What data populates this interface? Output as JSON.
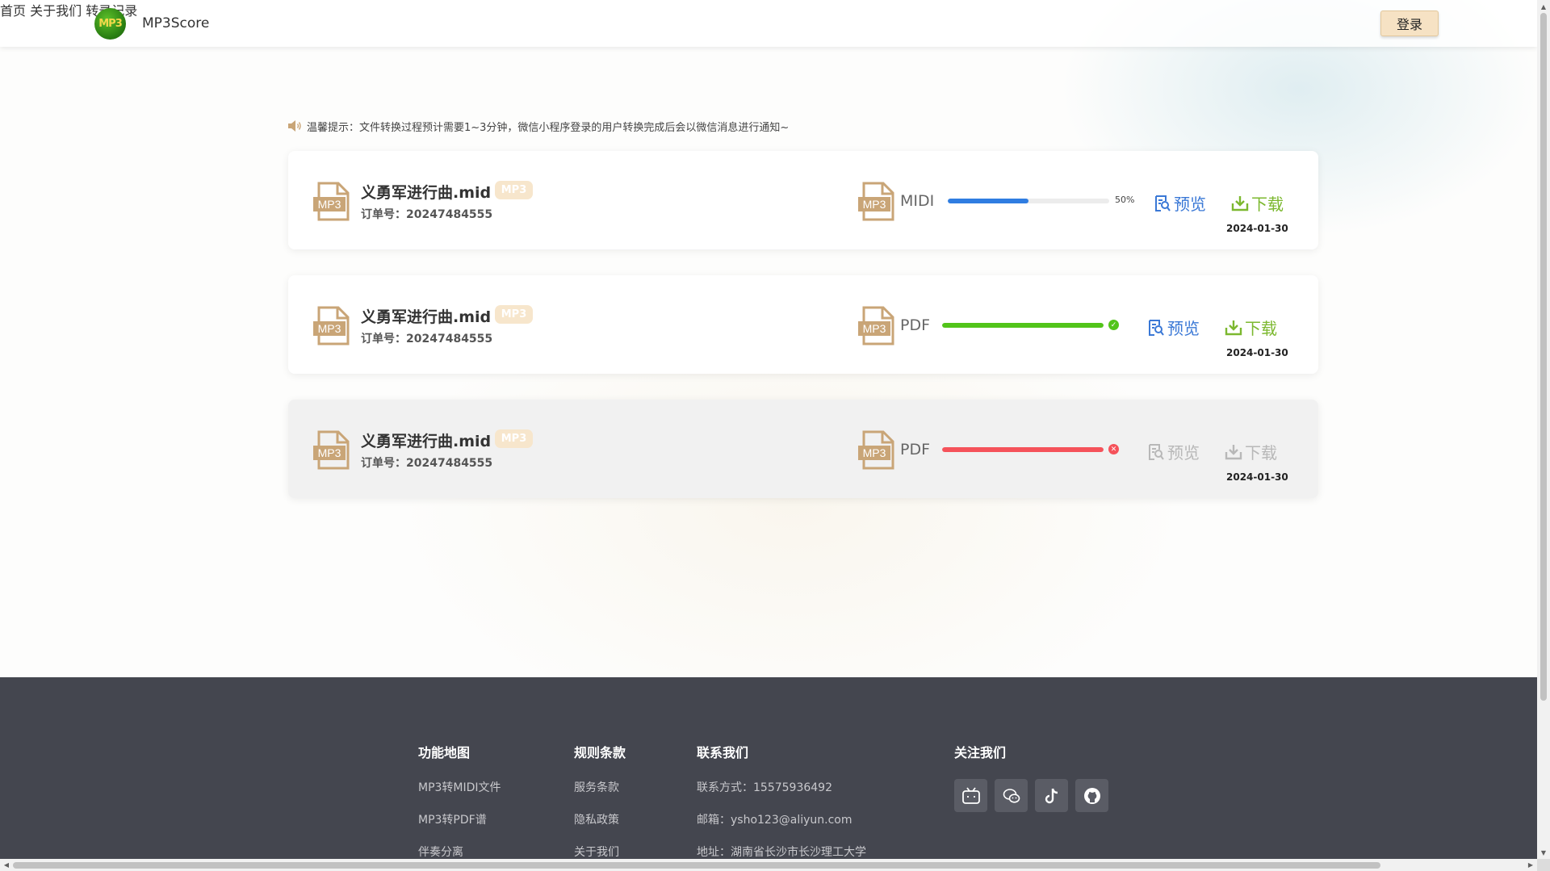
{
  "header": {
    "brand": "MP3Score",
    "logo_text": "MP3",
    "nav": [
      {
        "label": "首页"
      },
      {
        "label": "关于我们"
      },
      {
        "label": "转录记录"
      }
    ],
    "login_label": "登录"
  },
  "tip": {
    "icon": "speaker-icon",
    "text": "温馨提示：文件转换过程预计需要1~3分钟，微信小程序登录的用户转换完成后会以微信消息进行通知~"
  },
  "records": [
    {
      "file_name": "义勇军进行曲.mid",
      "badge": "MP3",
      "order": "订单号：20247484555",
      "output_format": "MIDI",
      "status": "in-progress",
      "progress_percent": 50,
      "progress_text": "50%",
      "progress_color": "#2f7de1",
      "preview_label": "预览",
      "download_label": "下载",
      "date": "2024-01-30"
    },
    {
      "file_name": "义勇军进行曲.mid",
      "badge": "MP3",
      "order": "订单号：20247484555",
      "output_format": "PDF",
      "status": "success",
      "progress_percent": 100,
      "progress_color": "#52c41a",
      "preview_label": "预览",
      "download_label": "下载",
      "date": "2024-01-30"
    },
    {
      "file_name": "义勇军进行曲.mid",
      "badge": "MP3",
      "order": "订单号：20247484555",
      "output_format": "PDF",
      "status": "failed",
      "progress_percent": 100,
      "progress_color": "#f5525a",
      "preview_label": "预览",
      "download_label": "下载",
      "date": "2024-01-30"
    }
  ],
  "colors": {
    "preview": "#3a78d6",
    "download": "#7cb82f",
    "disabled": "#b8b8b8",
    "file_icon": "#c9a577",
    "badge_bg": "#f7e6cc"
  },
  "footer": {
    "columns": [
      {
        "title": "功能地图",
        "links": [
          "MP3转MIDI文件",
          "MP3转PDF谱",
          "伴奏分离"
        ]
      },
      {
        "title": "规则条款",
        "links": [
          "服务条款",
          "隐私政策",
          "关于我们"
        ]
      },
      {
        "title": "联系我们",
        "links": [
          "联系方式：15575936492",
          "邮箱：ysho123@aliyun.com",
          "地址：湖南省长沙市长沙理工大学"
        ]
      }
    ],
    "follow_title": "关注我们",
    "social_icons": [
      "bilibili-icon",
      "wechat-icon",
      "tiktok-icon",
      "github-icon"
    ]
  }
}
